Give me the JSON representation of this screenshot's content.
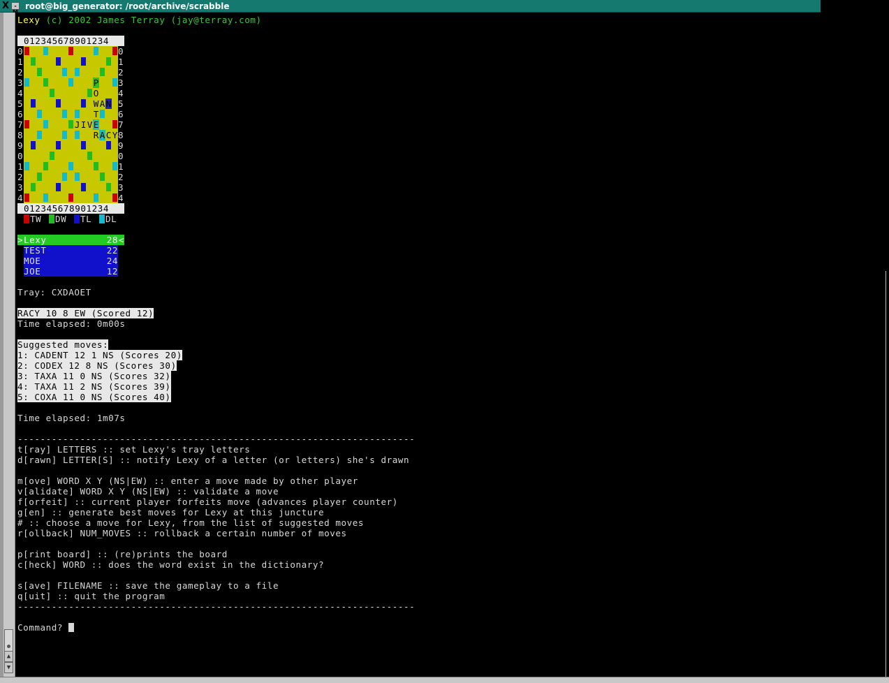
{
  "window": {
    "title": "root@big_generator: /root/archive/scrabble",
    "close_glyph": "X",
    "menu_glyph": "-M"
  },
  "header": {
    "app_name": "Lexy",
    "copyright": "(c) 2002 James Terray (jay@terray.com)"
  },
  "board": {
    "column_header": "012345678901234",
    "row_labels": [
      "0",
      "1",
      "2",
      "3",
      "4",
      "5",
      "6",
      "7",
      "8",
      "9",
      "0",
      "1",
      "2",
      "3",
      "4"
    ],
    "tiles": [
      {
        "row": 3,
        "col": 11,
        "letter": "P"
      },
      {
        "row": 4,
        "col": 11,
        "letter": "O"
      },
      {
        "row": 5,
        "col": 11,
        "letter": "W"
      },
      {
        "row": 5,
        "col": 12,
        "letter": "A"
      },
      {
        "row": 5,
        "col": 13,
        "letter": "N"
      },
      {
        "row": 6,
        "col": 11,
        "letter": "T"
      },
      {
        "row": 7,
        "col": 8,
        "letter": "J"
      },
      {
        "row": 7,
        "col": 9,
        "letter": "I"
      },
      {
        "row": 7,
        "col": 10,
        "letter": "V"
      },
      {
        "row": 7,
        "col": 11,
        "letter": "E"
      },
      {
        "row": 8,
        "col": 11,
        "letter": "R"
      },
      {
        "row": 8,
        "col": 12,
        "letter": "A"
      },
      {
        "row": 8,
        "col": 13,
        "letter": "C"
      },
      {
        "row": 8,
        "col": 14,
        "letter": "Y"
      }
    ],
    "colors": {
      "TW": "#cc0000",
      "DW": "#22bb22",
      "TL": "#1111cc",
      "DL": "#11bbcc",
      "board": "#c8c800"
    }
  },
  "legend": [
    {
      "code": "TW",
      "color": "#cc0000"
    },
    {
      "code": "DW",
      "color": "#22bb22"
    },
    {
      "code": "TL",
      "color": "#1111cc"
    },
    {
      "code": "DL",
      "color": "#11bbcc"
    }
  ],
  "players": [
    {
      "name": "Lexy",
      "score": "28",
      "active": true
    },
    {
      "name": "TEST",
      "score": "22",
      "active": false
    },
    {
      "name": "MOE",
      "score": "24",
      "active": false
    },
    {
      "name": "JOE",
      "score": "12",
      "active": false
    }
  ],
  "tray": "Tray: CXDAOET",
  "last_move": "RACY 10 8 EW (Scored 12)",
  "time_elapsed_1": "Time elapsed: 0m00s",
  "suggested": {
    "heading": "Suggested moves:",
    "moves": [
      "1: CADENT 12 1 NS (Scores 20)",
      "2: CODEX 12 8 NS (Scores 30)",
      "3: TAXA 11 0 NS (Scores 32)",
      "4: TAXA 11 2 NS (Scores 39)",
      "5: COXA 11 0 NS (Scores 40)"
    ]
  },
  "time_elapsed_2": "Time elapsed: 1m07s",
  "divider": "----------------------------------------------------------------------",
  "help": {
    "group1": [
      "t[ray] LETTERS :: set Lexy's tray letters",
      "d[rawn] LETTER[S] :: notify Lexy of a letter (or letters) she's drawn"
    ],
    "group2": [
      "m[ove] WORD X Y (NS|EW) :: enter a move made by other player",
      "v[alidate] WORD X Y (NS|EW) :: validate a move",
      "f[orfeit] :: current player forfeits move (advances player counter)",
      "g[en] :: generate best moves for Lexy at this juncture",
      "# :: choose a move for Lexy, from the list of suggested moves",
      "r[ollback] NUM_MOVES :: rollback a certain number of moves"
    ],
    "group3": [
      "p[rint board] :: (re)prints the board",
      "c[heck] WORD :: does the word exist in the dictionary?"
    ],
    "group4": [
      "s[ave] FILENAME :: save the gameplay to a file",
      "q[uit] :: quit the program"
    ]
  },
  "prompt": "Command?"
}
